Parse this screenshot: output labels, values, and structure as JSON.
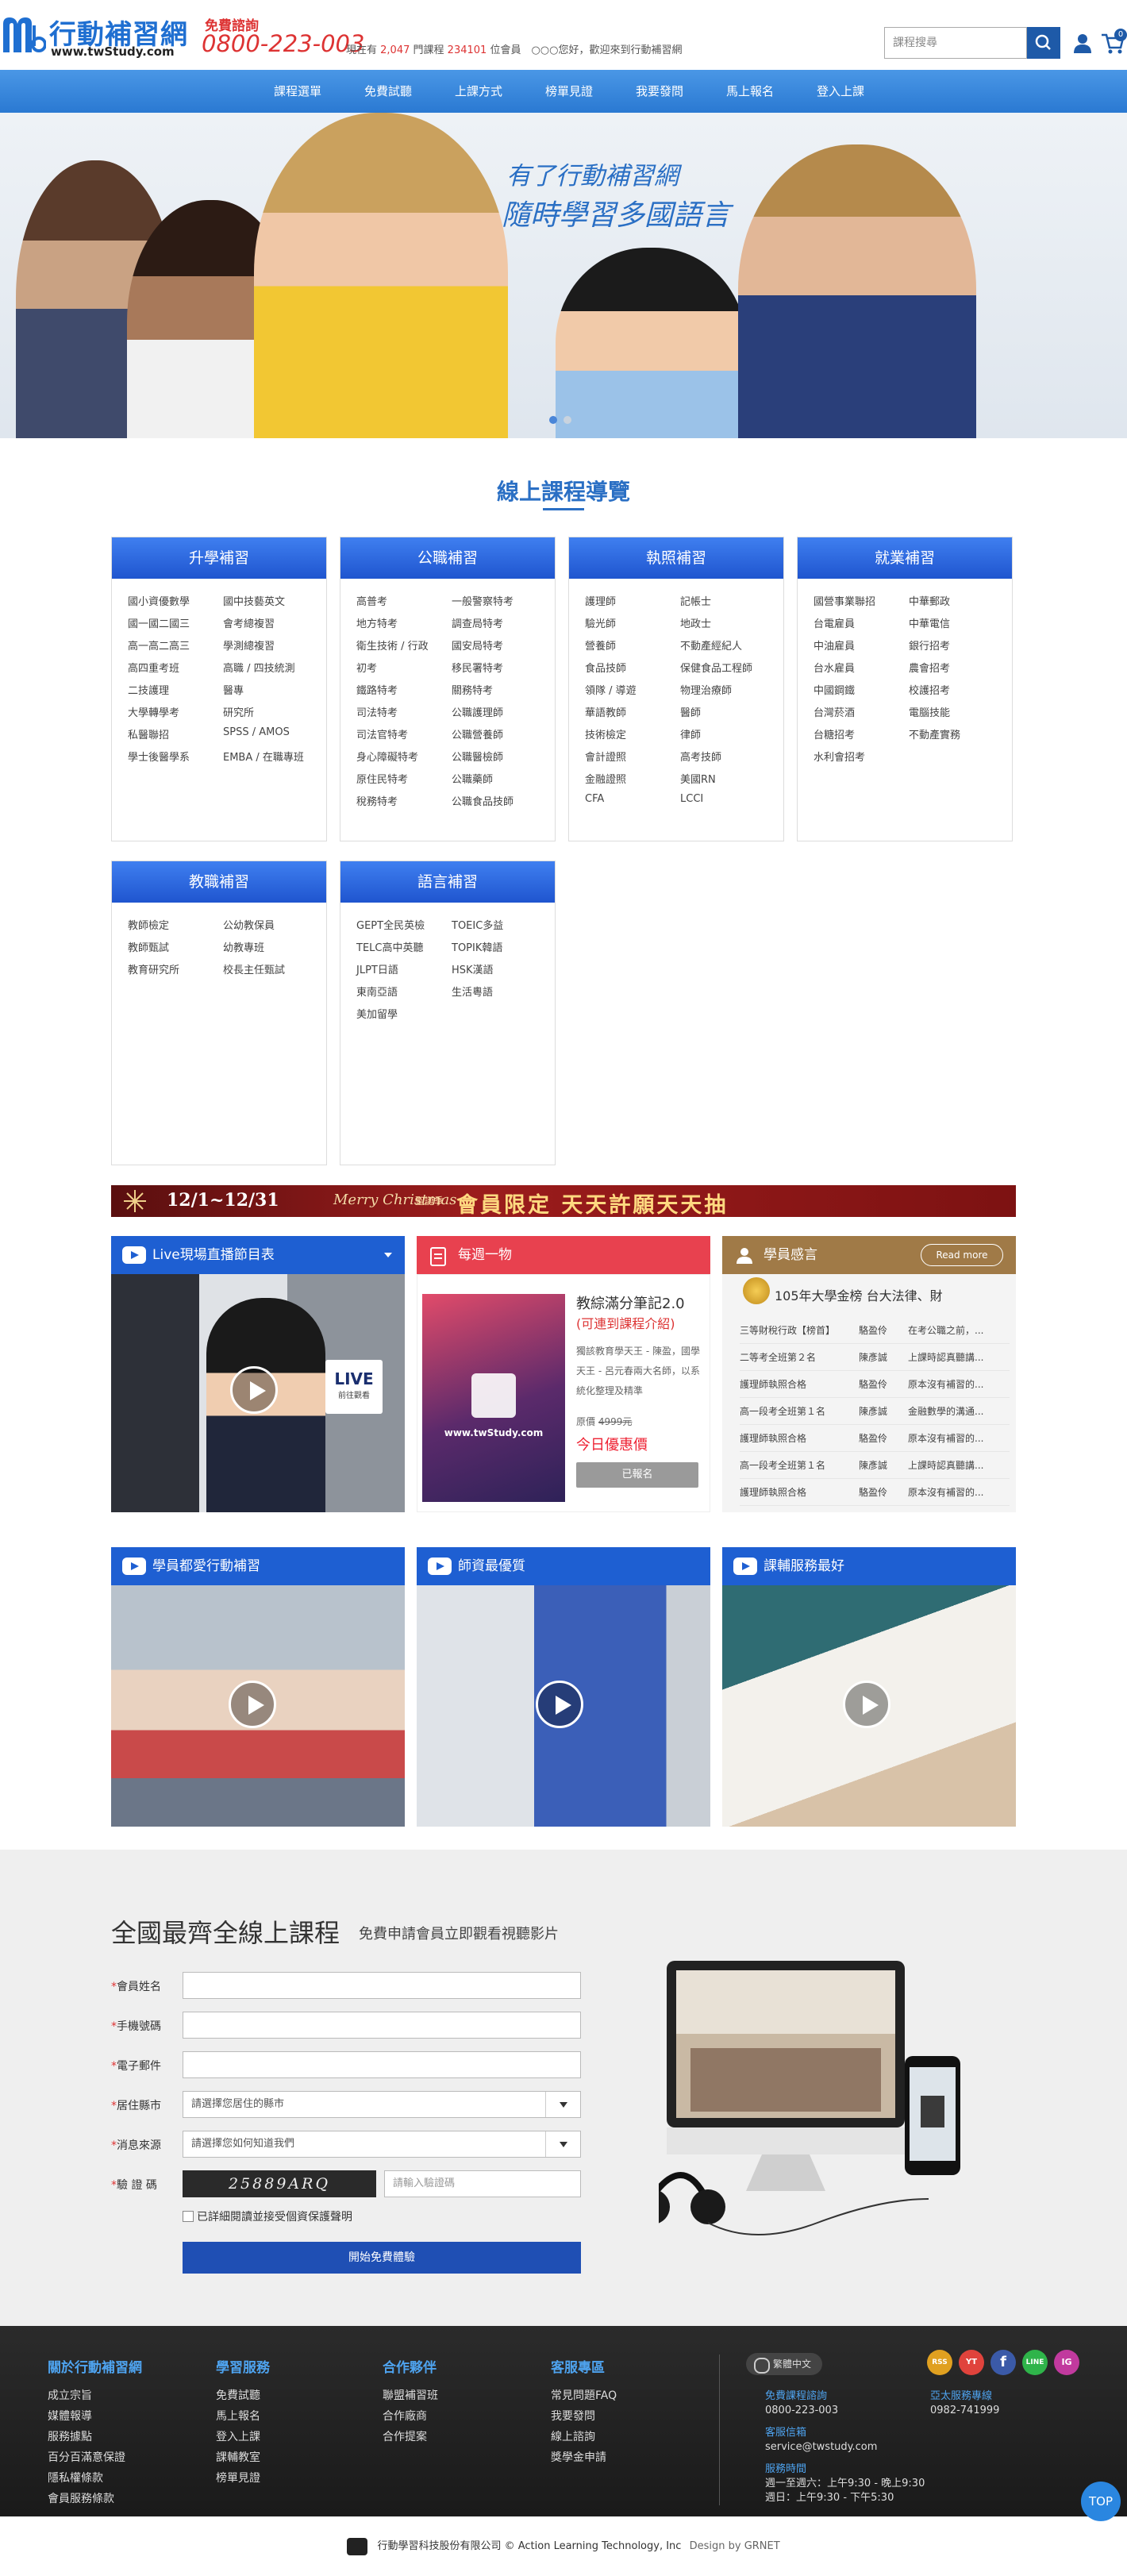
{
  "header": {
    "logo_name": "行動補習網",
    "logo_url": "www.twStudy.com",
    "hotline_label": "免費諮詢",
    "hotline_phone": "0800-223-003",
    "stats_prefix": "現在有",
    "course_count": "2,047",
    "stats_mid": "門課程",
    "member_count": "234101",
    "stats_suffix": "位會員　○○○您好，歡迎來到行動補習網",
    "search_placeholder": "課程搜尋",
    "cart_count": "0"
  },
  "nav": [
    "課程選單",
    "免費試聽",
    "上課方式",
    "榜單見證",
    "我要發問",
    "馬上報名",
    "登入上課"
  ],
  "hero": {
    "line1": "有了行動補習網",
    "line2": "隨時學習多國語言"
  },
  "section_title": "線上課程導覽",
  "categories": [
    {
      "title": "升學補習",
      "items": [
        "國小資優數學",
        "國中技藝英文",
        "國一國二國三",
        "會考總複習",
        "高一高二高三",
        "學測總複習",
        "高四重考班",
        "高職 / 四技統測",
        "二技護理",
        "醫專",
        "大學轉學考",
        "研究所",
        "私醫聯招",
        "SPSS / AMOS",
        "學士後醫學系",
        "EMBA / 在職專班"
      ]
    },
    {
      "title": "公職補習",
      "items": [
        "高普考",
        "一般警察特考",
        "地方特考",
        "調查局特考",
        "衛生技術 / 行政",
        "國安局特考",
        "初考",
        "移民署特考",
        "鐵路特考",
        "關務特考",
        "司法特考",
        "公職護理師",
        "司法官特考",
        "公職營養師",
        "身心障礙特考",
        "公職醫檢師",
        "原住民特考",
        "公職藥師",
        "稅務特考",
        "公職食品技師"
      ]
    },
    {
      "title": "執照補習",
      "items": [
        "護理師",
        "記帳士",
        "驗光師",
        "地政士",
        "營養師",
        "不動產經紀人",
        "食品技師",
        "保健食品工程師",
        "領隊 / 導遊",
        "物理治療師",
        "華語教師",
        "醫師",
        "技術檢定",
        "律師",
        "會計證照",
        "高考技師",
        "金融證照",
        "美國RN",
        "CFA",
        "LCCI"
      ]
    },
    {
      "title": "就業補習",
      "items": [
        "國營事業聯招",
        "中華郵政",
        "台電雇員",
        "中華電信",
        "中油雇員",
        "銀行招考",
        "台水雇員",
        "農會招考",
        "中國鋼鐵",
        "校護招考",
        "台灣菸酒",
        "電腦技能",
        "台糖招考",
        "不動產實務",
        "水利會招考"
      ]
    },
    {
      "title": "教職補習",
      "items": [
        "教師檢定",
        "公幼教保員",
        "教師甄試",
        "幼教專班",
        "教育研究所",
        "校長主任甄試"
      ]
    },
    {
      "title": "語言補習",
      "items": [
        "GEPT全民英檢",
        "TOEIC多益",
        "TELC高中英聽",
        "TOPIK韓語",
        "JLPT日語",
        "HSK漢語",
        "東南亞語",
        "生活粵語",
        "美加留學"
      ]
    }
  ],
  "banner": {
    "date": "12/1~12/31",
    "xmas": "Merry Christmas",
    "tag": "聖誕季",
    "main": "會員限定 天天許願天天抽"
  },
  "live_panel": {
    "title": "Live現場直播節目表",
    "badge": "LIVE",
    "badge_sub": "前往觀看"
  },
  "deal_panel": {
    "title": "每週一物",
    "book_title": "教綜滿分筆記2.0",
    "book_link": "(可連到課程介紹)",
    "book_desc": "獨該教育學天王 - 陳盈，國學天王 - 呂元春兩大名師，以系統化整理及精準",
    "orig_label": "原價",
    "orig_price": "4999元",
    "promo": "今日優惠價",
    "button": "已報名"
  },
  "review_panel": {
    "title": "學員感言",
    "read_more": "Read more",
    "top_line": "105年大學金榜 台大法律、財",
    "rows": [
      [
        "三等財稅行政【榜首】",
        "駱盈伶",
        "在考公職之前，..."
      ],
      [
        "二等考全班第２名",
        "陳彥誠",
        "上課時認真聽講..."
      ],
      [
        "護理師執照合格",
        "駱盈伶",
        "原本沒有補習的..."
      ],
      [
        "高一段考全班第１名",
        "陳彥誠",
        "金融數學的溝通..."
      ],
      [
        "護理師執照合格",
        "駱盈伶",
        "原本沒有補習的..."
      ],
      [
        "高一段考全班第１名",
        "陳彥誠",
        "上課時認真聽講..."
      ],
      [
        "護理師執照合格",
        "駱盈伶",
        "原本沒有補習的..."
      ]
    ]
  },
  "video_panels": [
    "學員都愛行動補習",
    "師資最優質",
    "課輔服務最好"
  ],
  "form": {
    "title": "全國最齊全線上課程",
    "subtitle": "免費申請會員立即觀看視聽影片",
    "fields": [
      {
        "label": "會員姓名",
        "value": ""
      },
      {
        "label": "手機號碼",
        "value": ""
      },
      {
        "label": "電子郵件",
        "value": ""
      },
      {
        "label": "居住縣市",
        "value": "請選擇您居住的縣市"
      },
      {
        "label": "消息來源",
        "value": "請選擇您如何知道我們"
      }
    ],
    "captcha_label": "驗 證 碼",
    "captcha_code": "25889ARQ",
    "captcha_placeholder": "請輸入驗證碼",
    "agree": "已詳細閱讀並接受個資保護聲明",
    "submit": "開始免費體驗"
  },
  "footer": {
    "cols": [
      {
        "title": "關於行動補習網",
        "items": [
          "成立宗旨",
          "媒體報導",
          "服務據點",
          "百分百滿意保證",
          "隱私權條款",
          "會員服務條款"
        ]
      },
      {
        "title": "學習服務",
        "items": [
          "免費試聽",
          "馬上報名",
          "登入上課",
          "課輔教室",
          "榜單見證"
        ]
      },
      {
        "title": "合作夥伴",
        "items": [
          "聯盟補習班",
          "合作廠商",
          "合作提案"
        ]
      },
      {
        "title": "客服專區",
        "items": [
          "常見問題FAQ",
          "我要發問",
          "線上諮詢",
          "獎學金申請"
        ]
      }
    ],
    "lang": "繁體中文",
    "consult_label": "免費課程諮詢",
    "consult_phone": "0800-223-003",
    "mail_label": "客服信箱",
    "mail": "service@twstudy.com",
    "hours_label": "服務時間",
    "hours1": "週一至週六：上午9:30 - 晚上9:30",
    "hours2": "週日：上午9:30 - 下午5:30",
    "offshore_label": "亞太服務專線",
    "offshore_phone": "0982-741999",
    "social": [
      "RSS",
      "YT",
      "f",
      "LINE",
      "IG"
    ],
    "copyright": "行動學習科技股份有限公司 © Action Learning Technology, Inc",
    "design": "Design by GRNET",
    "top": "TOP"
  }
}
